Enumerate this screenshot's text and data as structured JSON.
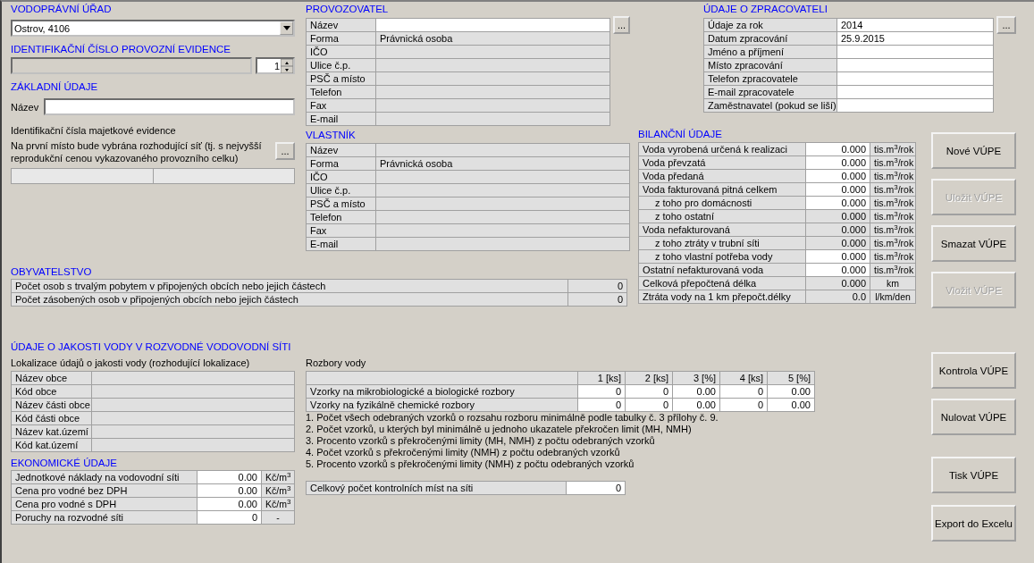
{
  "office": {
    "heading": "VODOPRÁVNÍ ÚŘAD",
    "value": "Ostrov, 4106"
  },
  "evidence": {
    "heading": "IDENTIFIKAČNÍ ČÍSLO PROVOZNÍ EVIDENCE",
    "spin_value": "1"
  },
  "basic": {
    "heading": "ZÁKLADNÍ ÚDAJE",
    "name_label": "Název",
    "property_label": "Identifikační čísla majetkové evidence",
    "note": "Na první místo bude vybrána rozhodující síť (tj. s nejvyšší reprodukční cenou vykazovaného provozního celku)",
    "browse_button": "..."
  },
  "operator": {
    "heading": "PROVOZOVATEL",
    "browse_button": "...",
    "rows": [
      {
        "label": "Název",
        "editable": true
      },
      {
        "label": "Forma",
        "value": "Právnická osoba",
        "editable": false
      },
      {
        "label": "IČO",
        "editable": false
      },
      {
        "label": "Ulice č.p.",
        "editable": false
      },
      {
        "label": "PSČ a místo",
        "editable": false
      },
      {
        "label": "Telefon",
        "editable": false
      },
      {
        "label": "Fax",
        "editable": false
      },
      {
        "label": "E-mail",
        "editable": false
      }
    ]
  },
  "owner": {
    "heading": "VLASTNÍK",
    "rows": [
      {
        "label": "Název",
        "editable": false
      },
      {
        "label": "Forma",
        "value": "Právnická osoba",
        "editable": false
      },
      {
        "label": "IČO",
        "editable": false
      },
      {
        "label": "Ulice č.p.",
        "editable": false
      },
      {
        "label": "PSČ a místo",
        "editable": false
      },
      {
        "label": "Telefon",
        "editable": false
      },
      {
        "label": "Fax",
        "editable": false
      },
      {
        "label": "E-mail",
        "editable": false
      }
    ]
  },
  "processor": {
    "heading": "ÚDAJE O ZPRACOVATELI",
    "browse_button": "...",
    "rows": [
      {
        "label": "Údaje za rok",
        "value": "2014",
        "editable": true
      },
      {
        "label": "Datum zpracování",
        "value": "25.9.2015",
        "editable": true
      },
      {
        "label": "Jméno a příjmení",
        "editable": true
      },
      {
        "label": "Místo zpracování",
        "editable": true
      },
      {
        "label": "Telefon zpracovatele",
        "editable": true
      },
      {
        "label": "E-mail zpracovatele",
        "editable": true
      },
      {
        "label": "Zaměstnavatel (pokud se liší)",
        "editable": true
      }
    ]
  },
  "balance": {
    "heading": "BILANČNÍ ÚDAJE",
    "rows": [
      {
        "label": "Voda vyrobená určená k realizaci",
        "value": "0.000",
        "unit": "tis.m$^{3}$/rok",
        "editable": true,
        "indented": false
      },
      {
        "label": "Voda převzatá",
        "value": "0.000",
        "unit": "tis.m$^{3}$/rok",
        "editable": true,
        "indented": false
      },
      {
        "label": "Voda předaná",
        "value": "0.000",
        "unit": "tis.m$^{3}$/rok",
        "editable": true,
        "indented": false
      },
      {
        "label": "Voda fakturovaná pitná celkem",
        "value": "0.000",
        "unit": "tis.m$^{3}$/rok",
        "editable": true,
        "indented": false
      },
      {
        "label": "z toho pro domácnosti",
        "value": "0.000",
        "unit": "tis.m$^{3}$/rok",
        "editable": true,
        "indented": true
      },
      {
        "label": "z toho ostatní",
        "value": "0.000",
        "unit": "tis.m$^{3}$/rok",
        "editable": false,
        "indented": true
      },
      {
        "label": "Voda nefakturovaná",
        "value": "0.000",
        "unit": "tis.m$^{3}$/rok",
        "editable": false,
        "indented": false
      },
      {
        "label": "z toho ztráty v trubní síti",
        "value": "0.000",
        "unit": "tis.m$^{3}$/rok",
        "editable": false,
        "indented": true
      },
      {
        "label": "z toho vlastní potřeba vody",
        "value": "0.000",
        "unit": "tis.m$^{3}$/rok",
        "editable": true,
        "indented": true
      },
      {
        "label": "Ostatní nefakturovaná voda",
        "value": "0.000",
        "unit": "tis.m$^{3}$/rok",
        "editable": true,
        "indented": false
      },
      {
        "label": "Celková přepočtená délka",
        "value": "0.000",
        "unit": "km",
        "editable": false,
        "indented": false
      },
      {
        "label": "Ztráta vody na 1 km přepočt.délky",
        "value": "0.0",
        "unit": "l/km/den",
        "editable": false,
        "indented": false
      }
    ]
  },
  "population": {
    "heading": "OBYVATELSTVO",
    "rows": [
      {
        "label": "Počet osob s trvalým pobytem v připojených obcích nebo jejich částech",
        "value": "0",
        "editable": false
      },
      {
        "label": "Počet zásobených osob v připojených obcích nebo jejich částech",
        "value": "0",
        "editable": false
      }
    ]
  },
  "quality": {
    "heading": "ÚDAJE O JAKOSTI VODY V ROZVODNÉ VODOVODNÍ SÍTI",
    "location_title": "Lokalizace údajů o jakosti vody (rozhodující lokalizace)",
    "location_rows": [
      {
        "label": "Název obce"
      },
      {
        "label": "Kód obce"
      },
      {
        "label": "Název části obce"
      },
      {
        "label": "Kód části obce"
      },
      {
        "label": "Název kat.území"
      },
      {
        "label": "Kód kat.území"
      }
    ],
    "analyses_title": "Rozbory vody",
    "columns": [
      "1 [ks]",
      "2 [ks]",
      "3 [%]",
      "4 [ks]",
      "5 [%]"
    ],
    "analyses_rows": [
      {
        "label": "Vzorky na mikrobiologické a biologické rozbory",
        "values": [
          "0",
          "0",
          "0.00",
          "0",
          "0.00"
        ]
      },
      {
        "label": "Vzorky na fyzikálně chemické rozbory",
        "values": [
          "0",
          "0",
          "0.00",
          "0",
          "0.00"
        ]
      }
    ],
    "notes": [
      "1. Počet všech odebraných vzorků o rozsahu rozboru minimálně podle tabulky č. 3 přílohy č. 9.",
      "2. Počet vzorků, u kterých byl minimálně u jednoho ukazatele překročen limit (MH, NMH)",
      "3. Procento vzorků s překročenými limity (MH, NMH) z počtu odebraných vzorků",
      "4. Počet vzorků s překročenými limity (NMH) z počtu odebraných vzorků",
      "5. Procento vzorků s překročenými limity (NMH) z počtu odebraných vzorků"
    ],
    "control_points": {
      "label": "Celkový počet kontrolních míst na síti",
      "value": "0"
    }
  },
  "economic": {
    "heading": "EKONOMICKÉ ÚDAJE",
    "rows": [
      {
        "label": "Jednotkové náklady na vodovodní síti",
        "value": "0.00",
        "unit": "Kč/m$^{3}$"
      },
      {
        "label": "Cena pro vodné bez DPH",
        "value": "0.00",
        "unit": "Kč/m$^{3}$"
      },
      {
        "label": "Cena pro vodné s DPH",
        "value": "0.00",
        "unit": "Kč/m$^{3}$"
      },
      {
        "label": "Poruchy na rozvodné síti",
        "value": "0",
        "unit": "-"
      }
    ]
  },
  "buttons": [
    {
      "label": "Nové VÚPE",
      "disabled": false
    },
    {
      "label": "Uložit VÚPE",
      "disabled": true
    },
    {
      "label": "Smazat VÚPE",
      "disabled": false
    },
    {
      "label": "Vložit VÚPE",
      "disabled": true
    },
    {
      "label": "Kontrola VÚPE",
      "disabled": false
    },
    {
      "label": "Nulovat VÚPE",
      "disabled": false
    },
    {
      "label": "Tisk VÚPE",
      "disabled": false
    },
    {
      "label": "Export do Excelu",
      "disabled": false
    }
  ]
}
